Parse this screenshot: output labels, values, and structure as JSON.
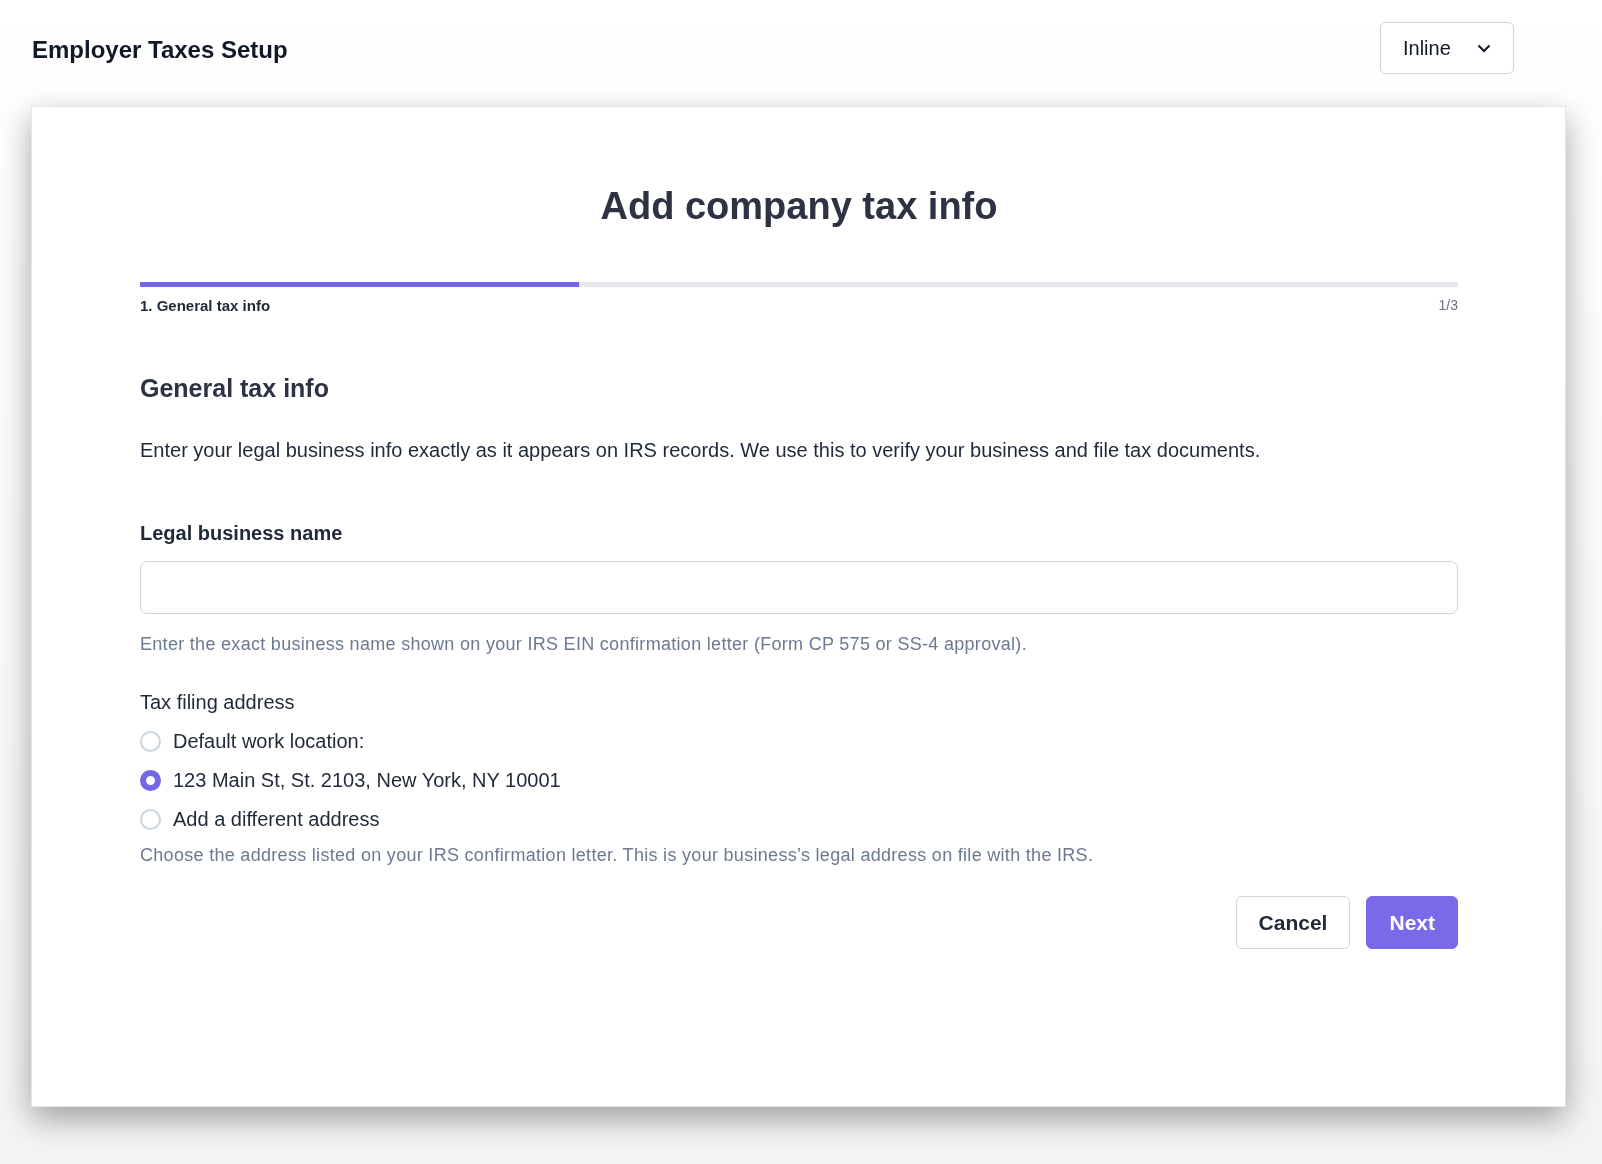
{
  "header": {
    "title": "Employer Taxes Setup",
    "mode_select": {
      "value": "Inline"
    }
  },
  "dialog": {
    "title": "Add company tax info",
    "progress": {
      "level": 0.333,
      "step_label": "1. General tax info",
      "step_count": "1/3"
    },
    "section_title": "General tax info",
    "description": "Enter your legal business info exactly as it appears on IRS records. We use this to verify your business and file tax documents.",
    "business_name": {
      "label": "Legal business name",
      "hint": "Enter the exact business name shown on your IRS EIN confirmation letter (Form CP 575 or SS-4 approval)."
    },
    "address": {
      "label": "Tax filing address",
      "options": [
        {
          "label": "Default work location:",
          "selected": false
        },
        {
          "label": "123 Main St, St. 2103, New York, NY 10001",
          "selected": true
        },
        {
          "label": "Add a different address",
          "selected": false
        }
      ],
      "hint": "Choose the address listed on your IRS confirmation letter. This is your business’s legal address on file with the IRS."
    },
    "buttons": [
      {
        "label": "Cancel",
        "kind": "secondary"
      },
      {
        "label": "Next",
        "kind": "primary"
      }
    ]
  }
}
